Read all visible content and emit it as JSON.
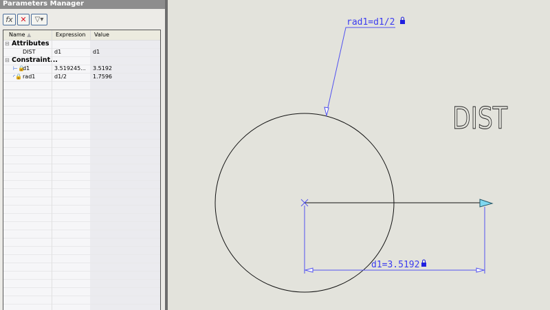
{
  "panel": {
    "title": "Parameters Manager",
    "toolbar": {
      "add": "fx",
      "delete": "✕",
      "filter": "▽▾"
    },
    "columns": [
      "Name",
      "Expression",
      "Value"
    ],
    "groups": [
      {
        "label": "Attributes",
        "rows": [
          {
            "name": "DIST",
            "expression": "d1",
            "value": "d1"
          }
        ]
      },
      {
        "label": "Constraint...",
        "rows": [
          {
            "name": "d1",
            "expression": "3.519245...",
            "value": "3.5192",
            "icon": "linear-dimension-lock-icon"
          },
          {
            "name": "rad1",
            "expression": "d1/2",
            "value": "1.7596",
            "icon": "radial-dimension-lock-icon"
          }
        ]
      }
    ]
  },
  "drawing": {
    "rad_label": "rad1=d1/2",
    "dim_label": "d1=3.5192",
    "attribute_text": "DIST",
    "dim_color": "#3b3bf0",
    "line_color": "#000000",
    "grip_color": "#7fd8f0"
  }
}
